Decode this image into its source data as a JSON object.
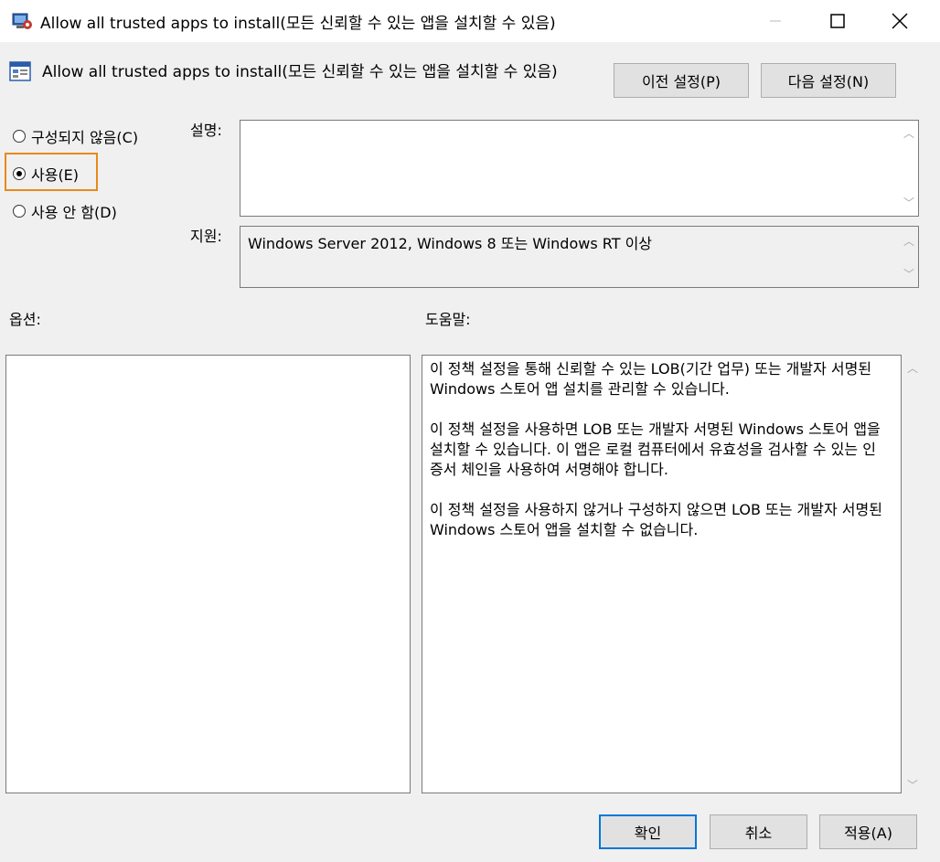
{
  "window": {
    "title": "Allow all trusted apps to install(모든 신뢰할 수 있는 앱을 설치할 수 있음)",
    "controls": [
      "minimize-icon",
      "maximize-icon",
      "close-icon"
    ]
  },
  "setting": {
    "title": "Allow all trusted apps to install(모든 신뢰할 수 있는 앱을 설치할 수 있음)",
    "prev_button": "이전 설정(P)",
    "next_button": "다음 설정(N)"
  },
  "state": {
    "options": [
      {
        "label": "구성되지 않음(C)",
        "checked": false
      },
      {
        "label": "사용(E)",
        "checked": true
      },
      {
        "label": "사용 안 함(D)",
        "checked": false
      }
    ]
  },
  "description": {
    "label": "설명:",
    "value": ""
  },
  "supported": {
    "label": "지원:",
    "value": "Windows Server 2012, Windows 8 또는 Windows RT 이상"
  },
  "options_section": {
    "label": "옵션:"
  },
  "help_section": {
    "label": "도움말:",
    "paragraphs": [
      "이 정책 설정을 통해 신뢰할 수 있는 LOB(기간 업무) 또는 개발자 서명된 Windows 스토어 앱 설치를 관리할 수 있습니다.",
      "이 정책 설정을 사용하면 LOB 또는 개발자 서명된 Windows 스토어 앱을 설치할 수 있습니다. 이 앱은 로컬 컴퓨터에서 유효성을 검사할 수 있는 인증서 체인을 사용하여 서명해야 합니다.",
      "이 정책 설정을 사용하지 않거나 구성하지 않으면 LOB 또는 개발자 서명된 Windows 스토어 앱을 설치할 수 없습니다."
    ]
  },
  "footer": {
    "ok": "확인",
    "cancel": "취소",
    "apply": "적용(A)"
  },
  "colors": {
    "highlight": "#e8891c",
    "default_button_border": "#0078d7"
  }
}
